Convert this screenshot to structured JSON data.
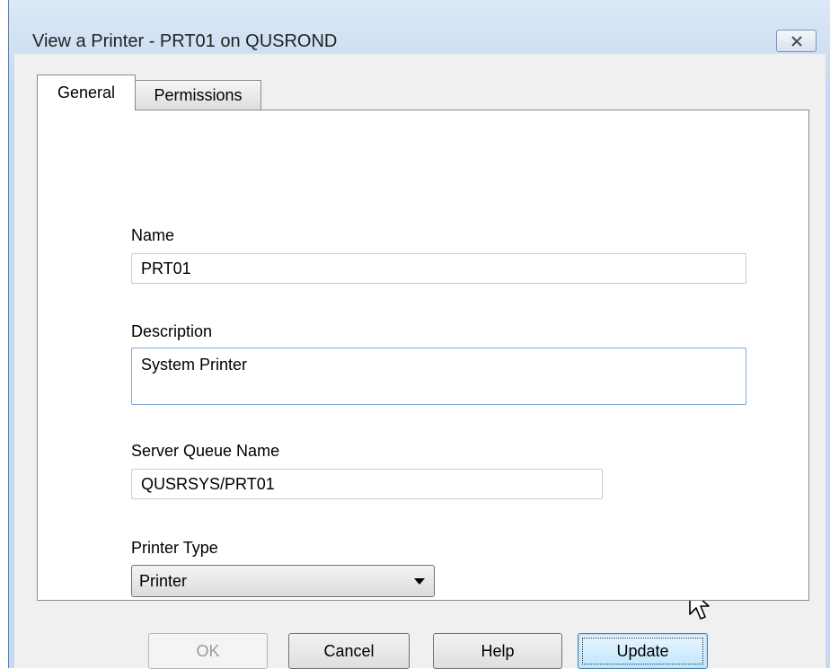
{
  "window": {
    "title": "View a Printer - PRT01 on QUSROND"
  },
  "tabs": [
    {
      "label": "General",
      "active": true
    },
    {
      "label": "Permissions",
      "active": false
    }
  ],
  "form": {
    "name_label": "Name",
    "name_value": "PRT01",
    "description_label": "Description",
    "description_value": "System Printer",
    "server_queue_label": "Server Queue Name",
    "server_queue_value": "QUSRSYS/PRT01",
    "printer_type_label": "Printer Type",
    "printer_type_value": "Printer"
  },
  "buttons": {
    "ok": "OK",
    "cancel": "Cancel",
    "help": "Help",
    "update": "Update"
  },
  "icons": {
    "close": "close-icon",
    "dropdown": "chevron-down-icon",
    "cursor": "mouse-pointer-icon"
  }
}
